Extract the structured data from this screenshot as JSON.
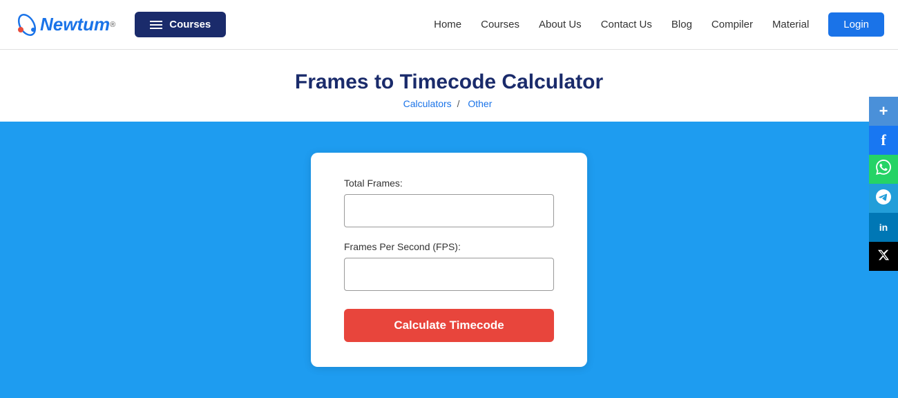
{
  "header": {
    "logo_new": "N",
    "logo_full": "Newtum",
    "logo_reg": "®",
    "courses_btn_label": "Courses",
    "nav": {
      "home": "Home",
      "courses": "Courses",
      "about_us": "About Us",
      "contact_us": "Contact Us",
      "blog": "Blog",
      "compiler": "Compiler",
      "material": "Material"
    },
    "login_label": "Login"
  },
  "page": {
    "title": "Frames to Timecode Calculator",
    "breadcrumb_calculators": "Calculators",
    "breadcrumb_separator": "/",
    "breadcrumb_other": "Other"
  },
  "calculator": {
    "total_frames_label": "Total Frames:",
    "total_frames_placeholder": "",
    "fps_label": "Frames Per Second (FPS):",
    "fps_placeholder": "",
    "calculate_btn_label": "Calculate Timecode"
  },
  "social": {
    "plus": "+",
    "facebook": "f",
    "whatsapp": "✆",
    "telegram": "✈",
    "linkedin": "in",
    "twitter": "𝕏"
  }
}
